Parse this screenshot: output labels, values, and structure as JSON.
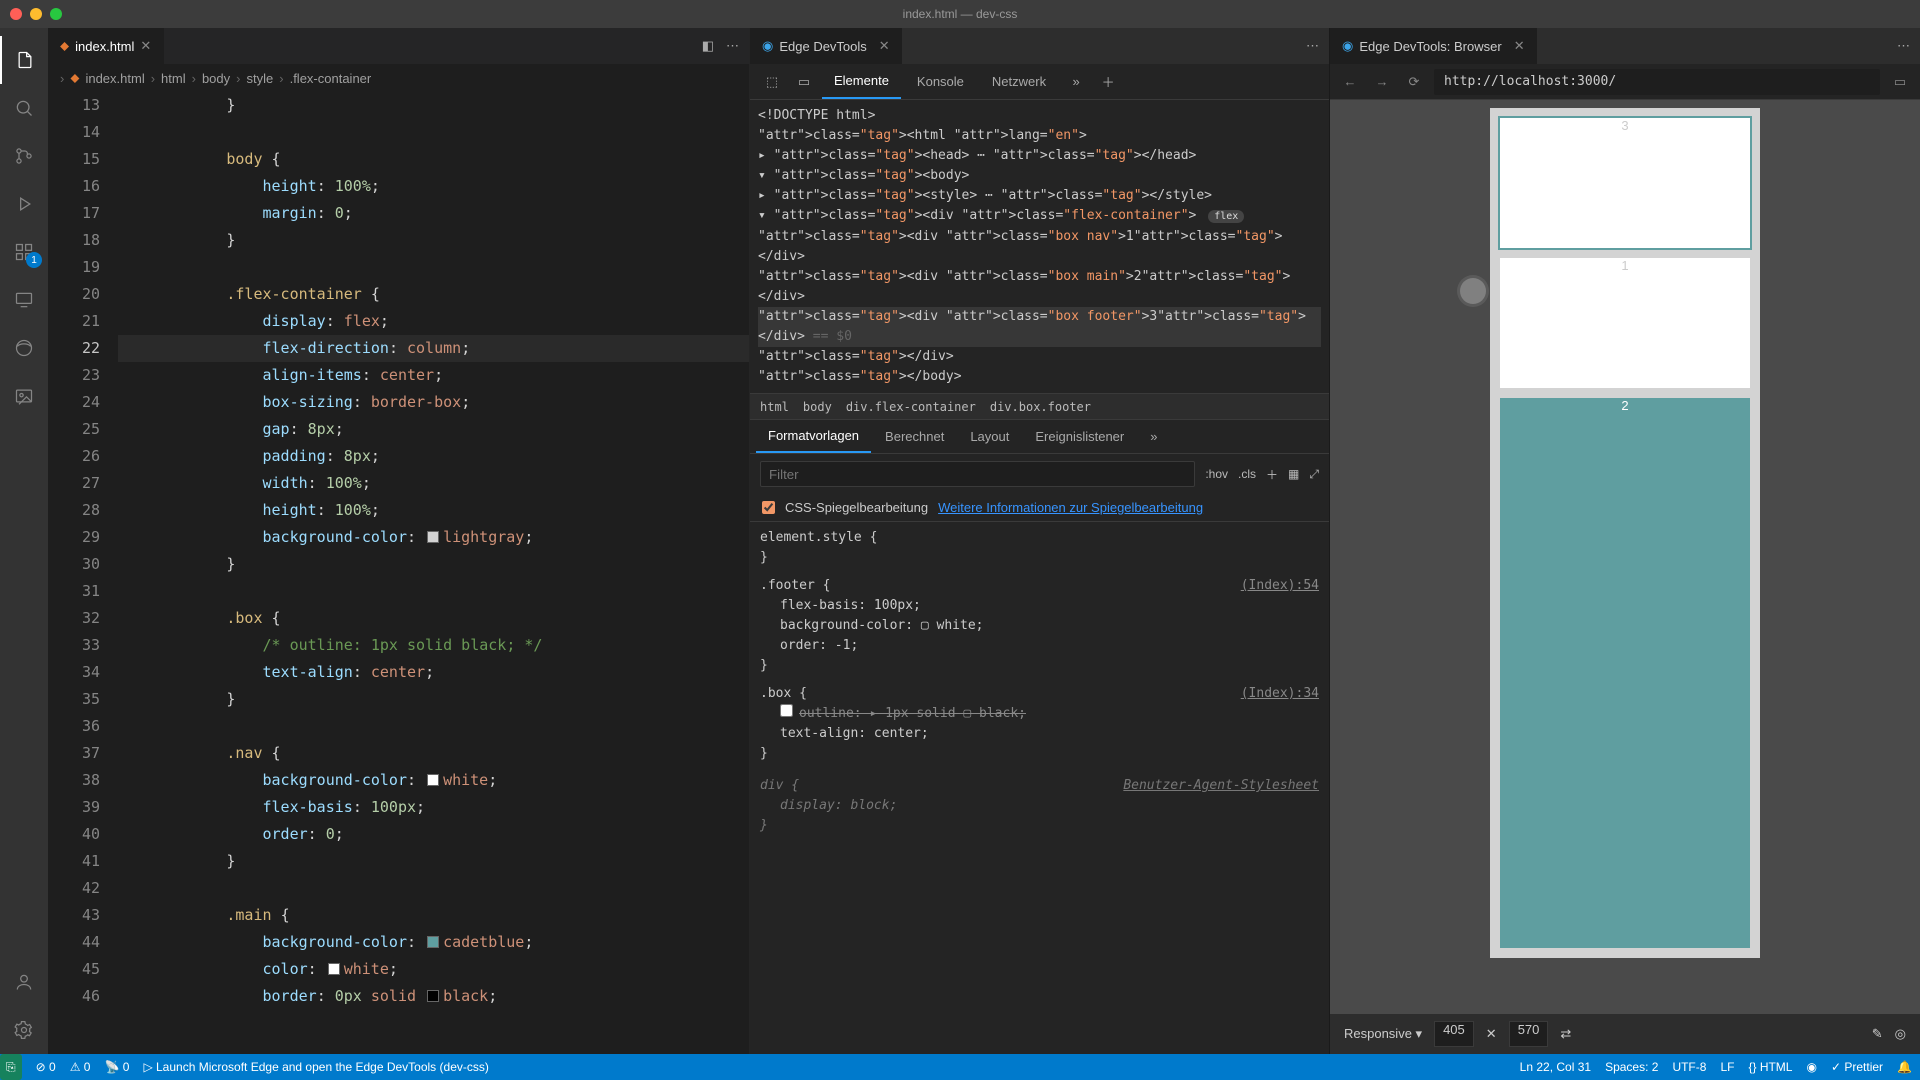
{
  "window": {
    "title": "index.html — dev-css"
  },
  "activitybar": {
    "badge": "1"
  },
  "editor": {
    "tab": "index.html",
    "breadcrumbs": [
      "index.html",
      "html",
      "body",
      "style",
      ".flex-container"
    ],
    "lines": [
      {
        "n": 13,
        "html": "            <span class='c-punc'>}</span>"
      },
      {
        "n": 14,
        "html": ""
      },
      {
        "n": 15,
        "html": "            <span class='c-sel'>body</span> <span class='c-punc'>{</span>"
      },
      {
        "n": 16,
        "html": "                <span class='c-prop'>height</span><span class='c-punc'>:</span> <span class='c-num'>100%</span><span class='c-punc'>;</span>"
      },
      {
        "n": 17,
        "html": "                <span class='c-prop'>margin</span><span class='c-punc'>:</span> <span class='c-num'>0</span><span class='c-punc'>;</span>"
      },
      {
        "n": 18,
        "html": "            <span class='c-punc'>}</span>"
      },
      {
        "n": 19,
        "html": ""
      },
      {
        "n": 20,
        "html": "            <span class='c-sel'>.flex-container</span> <span class='c-punc'>{</span>"
      },
      {
        "n": 21,
        "html": "                <span class='c-prop'>display</span><span class='c-punc'>:</span> <span class='c-val'>flex</span><span class='c-punc'>;</span>"
      },
      {
        "n": 22,
        "html": "                <span class='c-prop'>flex-direction</span><span class='c-punc'>:</span> <span class='c-val'>column</span><span class='c-punc'>;</span>",
        "active": true
      },
      {
        "n": 23,
        "html": "                <span class='c-prop'>align-items</span><span class='c-punc'>:</span> <span class='c-val'>center</span><span class='c-punc'>;</span>"
      },
      {
        "n": 24,
        "html": "                <span class='c-prop'>box-sizing</span><span class='c-punc'>:</span> <span class='c-val'>border-box</span><span class='c-punc'>;</span>"
      },
      {
        "n": 25,
        "html": "                <span class='c-prop'>gap</span><span class='c-punc'>:</span> <span class='c-num'>8px</span><span class='c-punc'>;</span>"
      },
      {
        "n": 26,
        "html": "                <span class='c-prop'>padding</span><span class='c-punc'>:</span> <span class='c-num'>8px</span><span class='c-punc'>;</span>"
      },
      {
        "n": 27,
        "html": "                <span class='c-prop'>width</span><span class='c-punc'>:</span> <span class='c-num'>100%</span><span class='c-punc'>;</span>"
      },
      {
        "n": 28,
        "html": "                <span class='c-prop'>height</span><span class='c-punc'>:</span> <span class='c-num'>100%</span><span class='c-punc'>;</span>"
      },
      {
        "n": 29,
        "html": "                <span class='c-prop'>background-color</span><span class='c-punc'>:</span> <span class='swatch' style='background:#d3d3d3'></span><span class='c-val'>lightgray</span><span class='c-punc'>;</span>"
      },
      {
        "n": 30,
        "html": "            <span class='c-punc'>}</span>"
      },
      {
        "n": 31,
        "html": ""
      },
      {
        "n": 32,
        "html": "            <span class='c-sel'>.box</span> <span class='c-punc'>{</span>"
      },
      {
        "n": 33,
        "html": "                <span class='c-comm'>/* outline: 1px solid black; */</span>"
      },
      {
        "n": 34,
        "html": "                <span class='c-prop'>text-align</span><span class='c-punc'>:</span> <span class='c-val'>center</span><span class='c-punc'>;</span>"
      },
      {
        "n": 35,
        "html": "            <span class='c-punc'>}</span>"
      },
      {
        "n": 36,
        "html": ""
      },
      {
        "n": 37,
        "html": "            <span class='c-sel'>.nav</span> <span class='c-punc'>{</span>"
      },
      {
        "n": 38,
        "html": "                <span class='c-prop'>background-color</span><span class='c-punc'>:</span> <span class='swatch' style='background:#fff'></span><span class='c-val'>white</span><span class='c-punc'>;</span>"
      },
      {
        "n": 39,
        "html": "                <span class='c-prop'>flex-basis</span><span class='c-punc'>:</span> <span class='c-num'>100px</span><span class='c-punc'>;</span>"
      },
      {
        "n": 40,
        "html": "                <span class='c-prop'>order</span><span class='c-punc'>:</span> <span class='c-num'>0</span><span class='c-punc'>;</span>"
      },
      {
        "n": 41,
        "html": "            <span class='c-punc'>}</span>"
      },
      {
        "n": 42,
        "html": ""
      },
      {
        "n": 43,
        "html": "            <span class='c-sel'>.main</span> <span class='c-punc'>{</span>"
      },
      {
        "n": 44,
        "html": "                <span class='c-prop'>background-color</span><span class='c-punc'>:</span> <span class='swatch' style='background:#5f9ea0'></span><span class='c-val'>cadetblue</span><span class='c-punc'>;</span>"
      },
      {
        "n": 45,
        "html": "                <span class='c-prop'>color</span><span class='c-punc'>:</span> <span class='swatch' style='background:#fff'></span><span class='c-val'>white</span><span class='c-punc'>;</span>"
      },
      {
        "n": 46,
        "html": "                <span class='c-prop'>border</span><span class='c-punc'>:</span> <span class='c-num'>0px</span> <span class='c-val'>solid</span> <span class='swatch' style='background:#000'></span><span class='c-val'>black</span><span class='c-punc'>;</span>"
      }
    ]
  },
  "devtools": {
    "tab": "Edge DevTools",
    "toptabs": [
      "Elemente",
      "Konsole",
      "Netzwerk"
    ],
    "dom": [
      "<!DOCTYPE html>",
      "<html lang=\"en\">",
      "  ▸ <head> ⋯ </head>",
      "  ▾ <body>",
      "    ▸ <style> ⋯ </style>",
      "    ▾ <div class=\"flex-container\"> [flex]",
      "        <div class=\"box nav\">1</div>",
      "        <div class=\"box main\">2</div>",
      "        <div class=\"box footer\">3</div>   == $0",
      "      </div>",
      "    </body>"
    ],
    "crumbs": [
      "html",
      "body",
      "div.flex-container",
      "div.box.footer"
    ],
    "stylestabs": [
      "Formatvorlagen",
      "Berechnet",
      "Layout",
      "Ereignislistener"
    ],
    "filter_placeholder": "Filter",
    "hov": ":hov",
    "cls": ".cls",
    "mirror_label": "CSS-Spiegelbearbeitung",
    "mirror_link": "Weitere Informationen zur Spiegelbearbeitung",
    "rules": {
      "element_style": "element.style {",
      "footer": {
        "sel": ".footer {",
        "file": "(Index):54",
        "decls": [
          "flex-basis: 100px;",
          "background-color: ▢ white;",
          "order: -1;"
        ]
      },
      "box": {
        "sel": ".box {",
        "file": "(Index):34",
        "outline": "outline: ▸ 1px solid ▢ black;",
        "textalign": "text-align: center;"
      },
      "div": {
        "sel": "div {",
        "ua": "Benutzer-Agent-Stylesheet",
        "display": "display: block;"
      }
    }
  },
  "browser": {
    "tab": "Edge DevTools: Browser",
    "url": "http://localhost:3000/",
    "boxes": {
      "footer": "3",
      "nav": "1",
      "main": "2"
    },
    "device": "Responsive",
    "width": "405",
    "height": "570"
  },
  "statusbar": {
    "errors": "0",
    "warnings": "0",
    "ports": "0",
    "launch": "Launch Microsoft Edge and open the Edge DevTools (dev-css)",
    "cursor": "Ln 22, Col 31",
    "spaces": "Spaces: 2",
    "encoding": "UTF-8",
    "eol": "LF",
    "lang": "HTML",
    "prettier": "Prettier"
  }
}
